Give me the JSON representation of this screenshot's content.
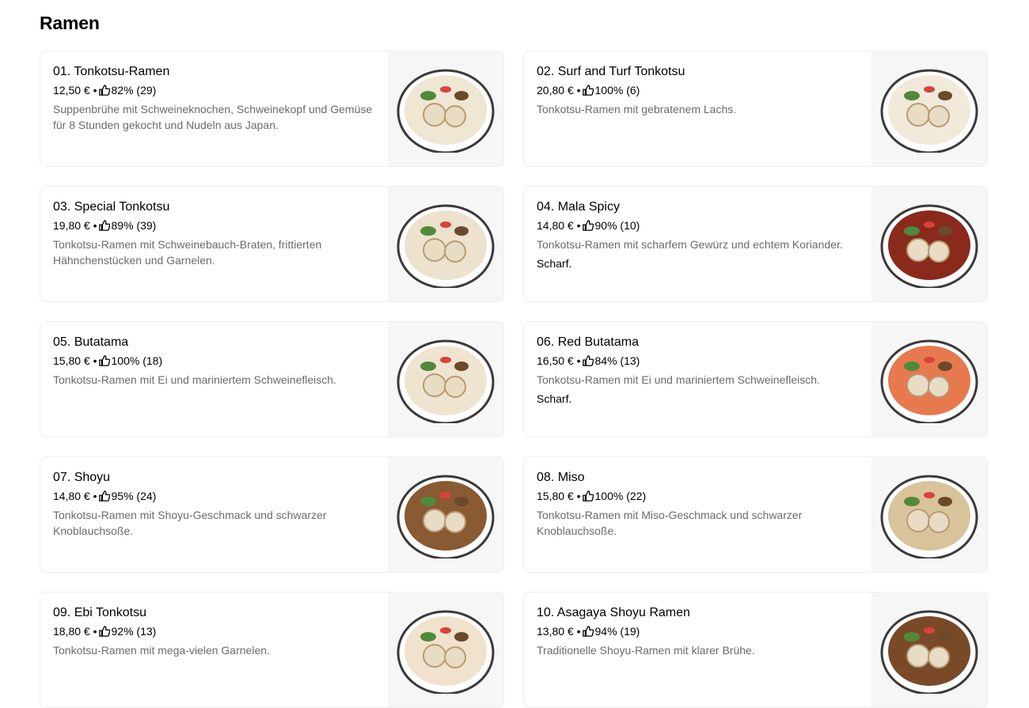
{
  "section": {
    "title": "Ramen"
  },
  "items": [
    {
      "name": "01. Tonkotsu-Ramen",
      "price": "12,50 €",
      "rating": "82% (29)",
      "description": "Suppenbrühe mit Schweineknochen, Schweinekopf und Gemüse für 8 Stunden gekocht und Nudeln aus Japan.",
      "tag": "",
      "image": "ramen-bowl-white-broth"
    },
    {
      "name": "02. Surf and Turf Tonkotsu",
      "price": "20,80 €",
      "rating": "100% (6)",
      "description": "Tonkotsu-Ramen mit gebratenem Lachs.",
      "tag": "",
      "image": "ramen-bowl-salmon"
    },
    {
      "name": "03. Special Tonkotsu",
      "price": "19,80 €",
      "rating": "89% (39)",
      "description": "Tonkotsu-Ramen mit Schweinebauch-Braten, frittierten Hähnchenstücken und Garnelen.",
      "tag": "",
      "image": "ramen-bowl-special"
    },
    {
      "name": "04. Mala Spicy",
      "price": "14,80 €",
      "rating": "90% (10)",
      "description": "Tonkotsu-Ramen mit scharfem Gewürz und echtem Koriander.",
      "tag": "Scharf.",
      "image": "ramen-bowl-spicy"
    },
    {
      "name": "05. Butatama",
      "price": "15,80 €",
      "rating": "100% (18)",
      "description": "Tonkotsu-Ramen mit Ei und mariniertem Schweinefleisch.",
      "tag": "",
      "image": "ramen-bowl-butatama"
    },
    {
      "name": "06. Red Butatama",
      "price": "16,50 €",
      "rating": "84% (13)",
      "description": "Tonkotsu-Ramen mit Ei und mariniertem Schweinefleisch.",
      "tag": "Scharf.",
      "image": "ramen-bowl-red-butatama"
    },
    {
      "name": "07. Shoyu",
      "price": "14,80 €",
      "rating": "95% (24)",
      "description": "Tonkotsu-Ramen mit Shoyu-Geschmack und schwarzer Knoblauchsoße.",
      "tag": "",
      "image": "ramen-bowl-shoyu"
    },
    {
      "name": "08. Miso",
      "price": "15,80 €",
      "rating": "100% (22)",
      "description": "Tonkotsu-Ramen mit Miso-Geschmack und schwarzer Knoblauchsoße.",
      "tag": "",
      "image": "ramen-bowl-miso"
    },
    {
      "name": "09. Ebi Tonkotsu",
      "price": "18,80 €",
      "rating": "92% (13)",
      "description": "Tonkotsu-Ramen mit mega-vielen Garnelen.",
      "tag": "",
      "image": "ramen-bowl-ebi"
    },
    {
      "name": "10. Asagaya Shoyu Ramen",
      "price": "13,80 €",
      "rating": "94% (19)",
      "description": "Traditionelle Shoyu-Ramen mit klarer Brühe.",
      "tag": "",
      "image": "ramen-bowl-asagaya"
    }
  ],
  "meta_separator": "•",
  "icons": {
    "rating": "thumbs-up-icon"
  },
  "colors": {
    "text": "#000000",
    "description": "#6b6b6b",
    "card_border": "#eeeeee",
    "image_bg": "#f6f6f6"
  }
}
